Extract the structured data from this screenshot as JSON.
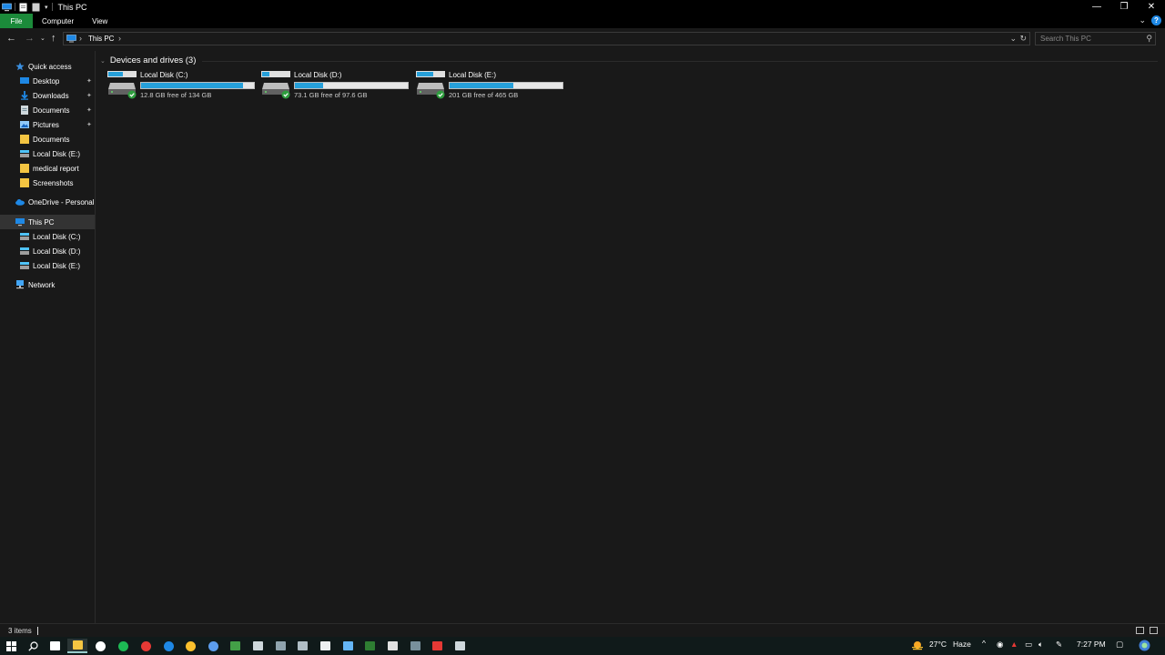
{
  "window": {
    "title": "This PC",
    "controls": {
      "minimize": "—",
      "restore": "❐",
      "close": "✕"
    }
  },
  "ribbon": {
    "tabs": [
      "File",
      "Computer",
      "View"
    ]
  },
  "address": {
    "crumbs": [
      "This PC"
    ],
    "separator": "›"
  },
  "search": {
    "placeholder": "Search This PC"
  },
  "nav": {
    "quick_access": "Quick access",
    "pinned": [
      {
        "label": "Desktop",
        "icon": "desktop-icon",
        "color": "#1e88e5",
        "pinned": true
      },
      {
        "label": "Downloads",
        "icon": "download-icon",
        "color": "#1e88e5",
        "pinned": true
      },
      {
        "label": "Documents",
        "icon": "documents-icon",
        "color": "#cfd8dc",
        "pinned": true
      },
      {
        "label": "Pictures",
        "icon": "pictures-icon",
        "color": "#90caf9",
        "pinned": true
      },
      {
        "label": "Documents",
        "icon": "folder-icon",
        "color": "#f4c542",
        "pinned": false
      },
      {
        "label": "Local Disk (E:)",
        "icon": "drive-icon",
        "color": "#9e9e9e",
        "pinned": false
      },
      {
        "label": "medical report",
        "icon": "folder-icon",
        "color": "#f4c542",
        "pinned": false
      },
      {
        "label": "Screenshots",
        "icon": "folder-icon",
        "color": "#f4c542",
        "pinned": false
      }
    ],
    "onedrive": "OneDrive - Personal",
    "this_pc": "This PC",
    "drives": [
      "Local Disk (C:)",
      "Local Disk (D:)",
      "Local Disk (E:)"
    ],
    "network": "Network"
  },
  "content": {
    "group_title": "Devices and drives (3)",
    "drives": [
      {
        "name": "Local Disk (C:)",
        "free_text": "12.8 GB free of 134 GB",
        "used_fraction": 0.904
      },
      {
        "name": "Local Disk (D:)",
        "free_text": "73.1 GB free of 97.6 GB",
        "used_fraction": 0.251
      },
      {
        "name": "Local Disk (E:)",
        "free_text": "201 GB free of 465 GB",
        "used_fraction": 0.568
      }
    ]
  },
  "status": {
    "item_count": "3 items"
  },
  "taskbar": {
    "weather": "27°C",
    "weather_desc": "Haze",
    "time": "7:27 PM",
    "apps": [
      {
        "name": "task-view-icon",
        "color": "#ffffff",
        "shape": "sq"
      },
      {
        "name": "file-explorer-icon",
        "color": "#f4c542",
        "shape": "sq",
        "active": true
      },
      {
        "name": "media-player-icon",
        "color": "#ffffff",
        "shape": "dot"
      },
      {
        "name": "spotify-icon",
        "color": "#1db954",
        "shape": "dot"
      },
      {
        "name": "opera-icon",
        "color": "#e53935",
        "shape": "dot"
      },
      {
        "name": "edge-icon",
        "color": "#1e88e5",
        "shape": "dot"
      },
      {
        "name": "chrome-icon",
        "color": "#fbc02d",
        "shape": "dot"
      },
      {
        "name": "browser-icon",
        "color": "#5c9ded",
        "shape": "dot"
      },
      {
        "name": "app-icon",
        "color": "#43a047",
        "shape": "sq"
      },
      {
        "name": "app-icon",
        "color": "#cfd8dc",
        "shape": "sq"
      },
      {
        "name": "app-icon",
        "color": "#90a4ae",
        "shape": "sq"
      },
      {
        "name": "app-icon",
        "color": "#b0bec5",
        "shape": "sq"
      },
      {
        "name": "app-icon",
        "color": "#eceff1",
        "shape": "sq"
      },
      {
        "name": "app-icon",
        "color": "#64b5f6",
        "shape": "sq"
      },
      {
        "name": "app-icon",
        "color": "#2e7d32",
        "shape": "sq"
      },
      {
        "name": "app-icon",
        "color": "#e0e0e0",
        "shape": "sq"
      },
      {
        "name": "app-icon",
        "color": "#78909c",
        "shape": "sq"
      },
      {
        "name": "app-icon",
        "color": "#e53935",
        "shape": "sq"
      },
      {
        "name": "app-icon",
        "color": "#cfd8dc",
        "shape": "sq"
      }
    ]
  }
}
